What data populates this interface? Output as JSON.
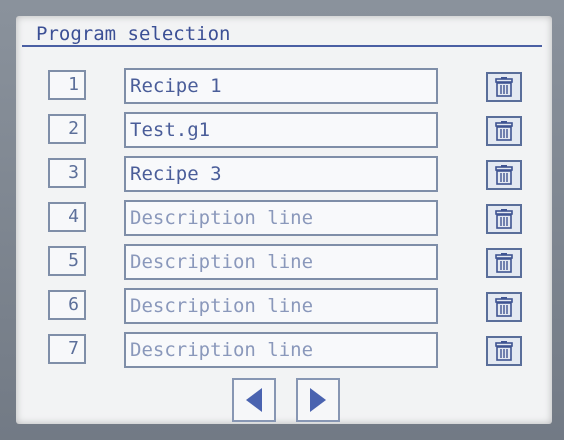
{
  "title": "Program selection",
  "programs": [
    {
      "number": "1",
      "description": "Recipe 1",
      "dim": false
    },
    {
      "number": "2",
      "description": "Test.g1",
      "dim": false
    },
    {
      "number": "3",
      "description": "Recipe 3",
      "dim": false
    },
    {
      "number": "4",
      "description": "Description line",
      "dim": true
    },
    {
      "number": "5",
      "description": "Description line",
      "dim": true
    },
    {
      "number": "6",
      "description": "Description line",
      "dim": true
    },
    {
      "number": "7",
      "description": "Description line",
      "dim": true
    }
  ],
  "icons": {
    "delete": "trash-icon",
    "prev": "arrow-left-icon",
    "next": "arrow-right-icon"
  },
  "colors": {
    "accent": "#3b4f95",
    "border": "#7f8ea8",
    "background": "#f2f3f4"
  }
}
